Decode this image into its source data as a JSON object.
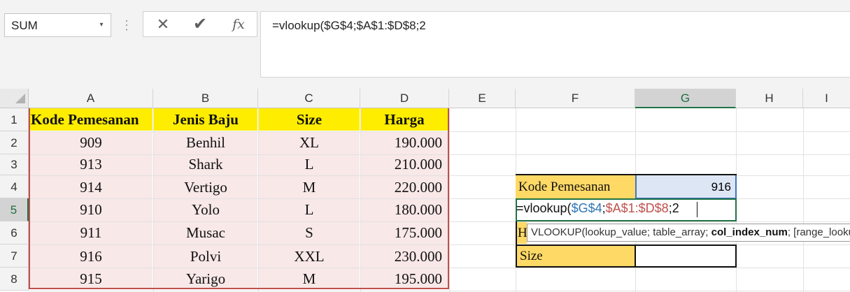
{
  "formula_bar": {
    "name_box": "SUM",
    "cancel_glyph": "✕",
    "enter_glyph": "✔",
    "fx_label": "fx",
    "formula": "=vlookup($G$4;$A$1:$D$8;2"
  },
  "columns": [
    "A",
    "B",
    "C",
    "D",
    "E",
    "F",
    "G",
    "H",
    "I"
  ],
  "rows": [
    "1",
    "2",
    "3",
    "4",
    "5",
    "6",
    "7",
    "8"
  ],
  "table": {
    "headers": [
      "Kode Pemesanan",
      "Jenis Baju",
      "Size",
      "Harga"
    ],
    "rows": [
      [
        "909",
        "Benhil",
        "XL",
        "190.000"
      ],
      [
        "913",
        "Shark",
        "L",
        "210.000"
      ],
      [
        "914",
        "Vertigo",
        "M",
        "220.000"
      ],
      [
        "910",
        "Yolo",
        "L",
        "180.000"
      ],
      [
        "911",
        "Musac",
        "S",
        "175.000"
      ],
      [
        "916",
        "Polvi",
        "XXL",
        "230.000"
      ],
      [
        "915",
        "Yarigo",
        "M",
        "195.000"
      ]
    ]
  },
  "lookup": {
    "label_kode": "Kode Pemesanan",
    "value_kode": "916",
    "label_h": "H",
    "label_size": "Size"
  },
  "editing": {
    "prefix": "=vlookup(",
    "ref1": "$G$4",
    "sep1": ";",
    "ref2": "$A$1:$D$8",
    "suffix": ";2"
  },
  "tooltip": {
    "prefix": "VLOOKUP(lookup_value; table_array; ",
    "bold": "col_index_num",
    "suffix": "; [range_lookup])"
  },
  "colors": {
    "header_yellow": "#ffed00",
    "row_pink": "#f9e8e8",
    "lookup_orange": "#ffd966",
    "excel_green": "#217346",
    "selection_blue": "#4472c4",
    "table_border_red": "#c0504d"
  }
}
